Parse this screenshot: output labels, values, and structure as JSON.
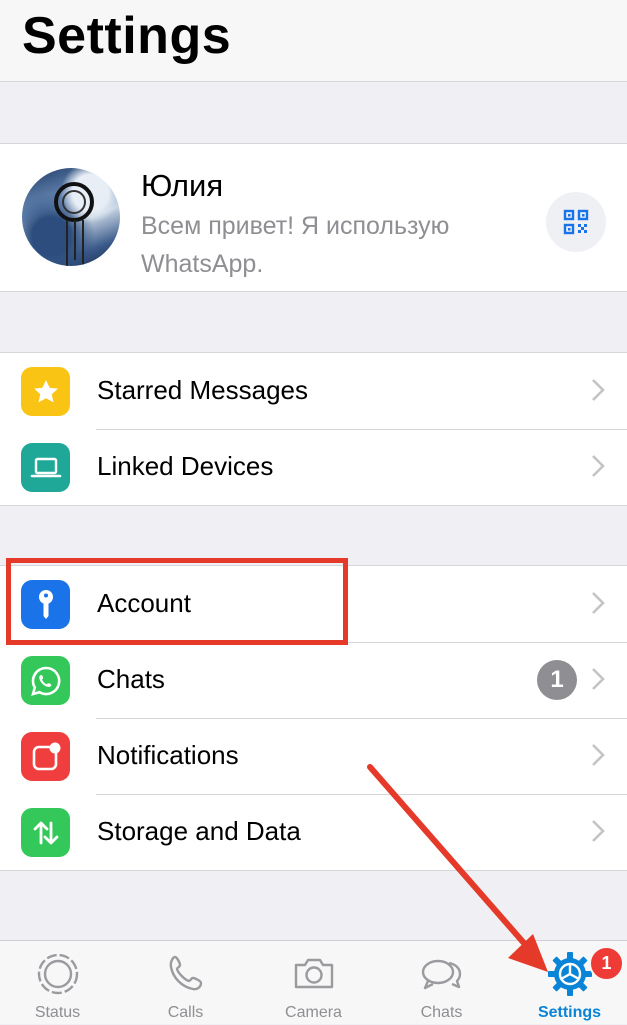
{
  "header": {
    "title": "Settings"
  },
  "profile": {
    "name": "Юлия",
    "status": "Всем привет! Я использую WhatsApp."
  },
  "group1": [
    {
      "label": "Starred Messages",
      "icon": "star-icon",
      "color": "#f9c414"
    },
    {
      "label": "Linked Devices",
      "icon": "laptop-icon",
      "color": "#1fa897"
    }
  ],
  "group2": [
    {
      "label": "Account",
      "icon": "key-icon",
      "color": "#1a73e8"
    },
    {
      "label": "Chats",
      "icon": "whatsapp-icon",
      "color": "#34c759",
      "badge": "1"
    },
    {
      "label": "Notifications",
      "icon": "notification-icon",
      "color": "#f03e3e"
    },
    {
      "label": "Storage and Data",
      "icon": "storage-arrows-icon",
      "color": "#34c759"
    }
  ],
  "tabbar": {
    "tabs": [
      {
        "label": "Status",
        "icon": "status-icon"
      },
      {
        "label": "Calls",
        "icon": "phone-icon"
      },
      {
        "label": "Camera",
        "icon": "camera-icon"
      },
      {
        "label": "Chats",
        "icon": "chat-bubbles-icon"
      },
      {
        "label": "Settings",
        "icon": "settings-gear-icon",
        "active": true,
        "badge": "1"
      }
    ]
  },
  "colors": {
    "accent": "#0a84d6",
    "annotation": "#e53a2a"
  }
}
